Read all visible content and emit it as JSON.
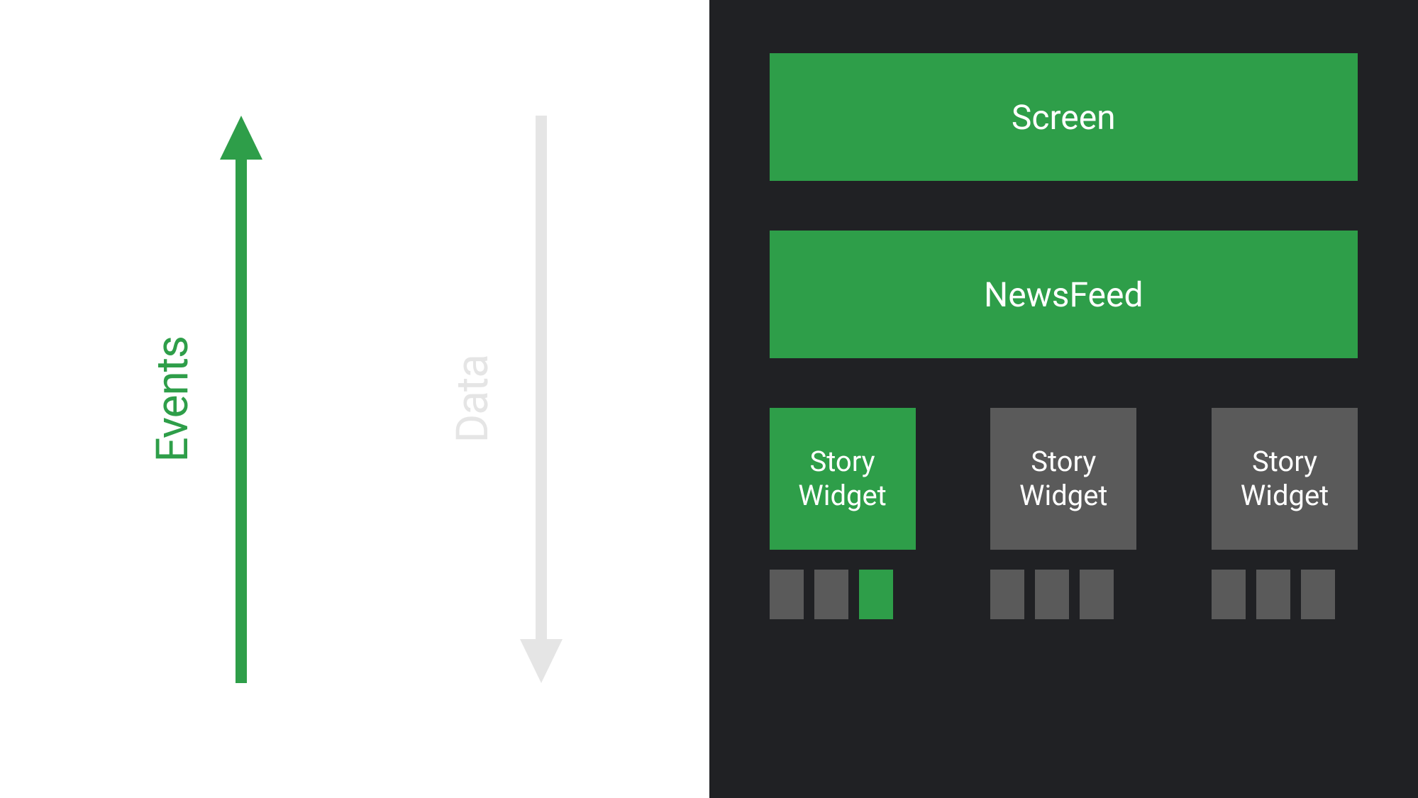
{
  "left": {
    "events_label": "Events",
    "data_label": "Data"
  },
  "right": {
    "screen_label": "Screen",
    "newsfeed_label": "NewsFeed",
    "widgets": [
      {
        "label": "Story\nWidget",
        "active": true,
        "small_active_index": 2
      },
      {
        "label": "Story\nWidget",
        "active": false,
        "small_active_index": -1
      },
      {
        "label": "Story\nWidget",
        "active": false,
        "small_active_index": -1
      }
    ]
  },
  "colors": {
    "green": "#2E9E49",
    "gray": "#5A5A5A",
    "light_gray": "#E5E5E5",
    "dark_bg": "#202124"
  }
}
